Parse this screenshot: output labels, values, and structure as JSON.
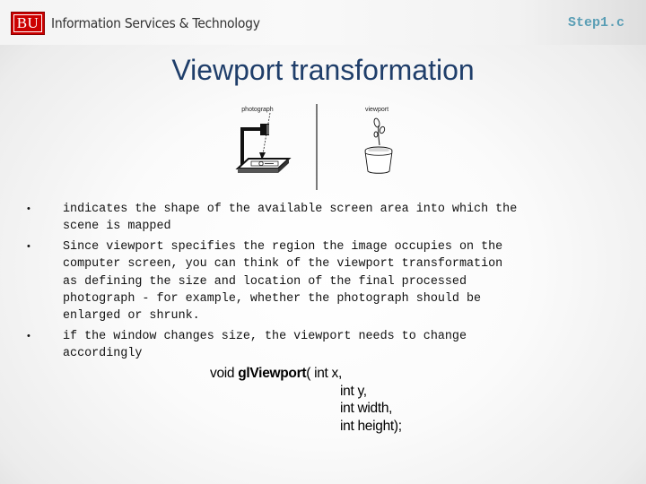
{
  "header": {
    "logo_text": "BU",
    "organization": "Information Services & Technology",
    "file_label": "Step1.c",
    "brand_color": "#cc0000",
    "file_label_color": "#5a9eb5"
  },
  "slide": {
    "title": "Viewport transformation",
    "title_color": "#1f3e6a",
    "figure": {
      "left_label": "photograph",
      "right_label": "viewport"
    },
    "bullets": [
      {
        "marker": "•",
        "text": "indicates the shape of the available screen area into which the\nscene is mapped"
      },
      {
        "marker": "•",
        "text": "Since viewport specifies the region the image occupies on the\ncomputer screen, you can think of the viewport transformation\nas defining the size and location of the final processed\nphotograph - for example, whether the photograph should be\nenlarged or shrunk."
      },
      {
        "marker": "•",
        "text": "if the window changes size, the viewport needs to change\naccordingly"
      }
    ],
    "code": {
      "return_type": "void",
      "function_name": "glViewport",
      "open_paren": "( ",
      "params": [
        "int x,",
        "int y,",
        "int width,",
        "int height);"
      ]
    }
  }
}
